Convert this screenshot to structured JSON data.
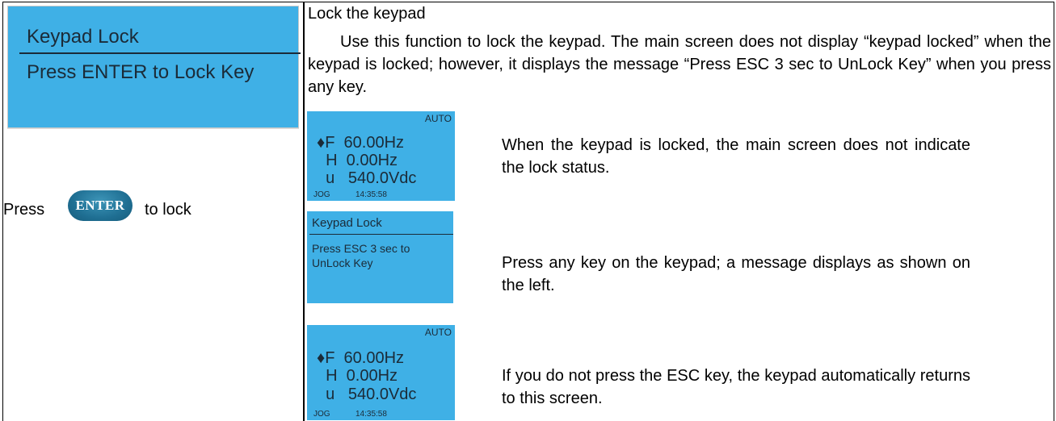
{
  "left": {
    "lcd": {
      "title": "Keypad Lock",
      "message": "Press ENTER to Lock Key"
    },
    "press_label": "Press",
    "enter_key_label": "ENTER",
    "to_lock_label": "to lock"
  },
  "right": {
    "heading": "Lock the keypad",
    "paragraph": "Use this function to lock the keypad. The main screen does not display “keypad locked” when the keypad is locked; however, it displays the message “Press ESC 3 sec to UnLock Key” when you press any key.",
    "screen1": {
      "mode": "AUTO",
      "line_f": "♦F  60.00Hz",
      "line_h": "  H  0.00Hz",
      "line_u": "  u   540.0Vdc",
      "jog": "JOG",
      "time": "14:35:58"
    },
    "screen2": {
      "title": "Keypad Lock",
      "message": "Press ESC 3 sec to UnLock Key"
    },
    "screen3": {
      "mode": "AUTO",
      "line_f": "♦F  60.00Hz",
      "line_h": "  H  0.00Hz",
      "line_u": "  u   540.0Vdc",
      "jog": "JOG",
      "time": "14:35:58"
    },
    "desc1": "When the keypad is locked, the main screen does not indicate the lock status.",
    "desc2": "Press any key on the keypad; a message displays as shown on the left.",
    "desc3": "If you do not press the ESC key, the keypad automatically returns to this screen."
  }
}
